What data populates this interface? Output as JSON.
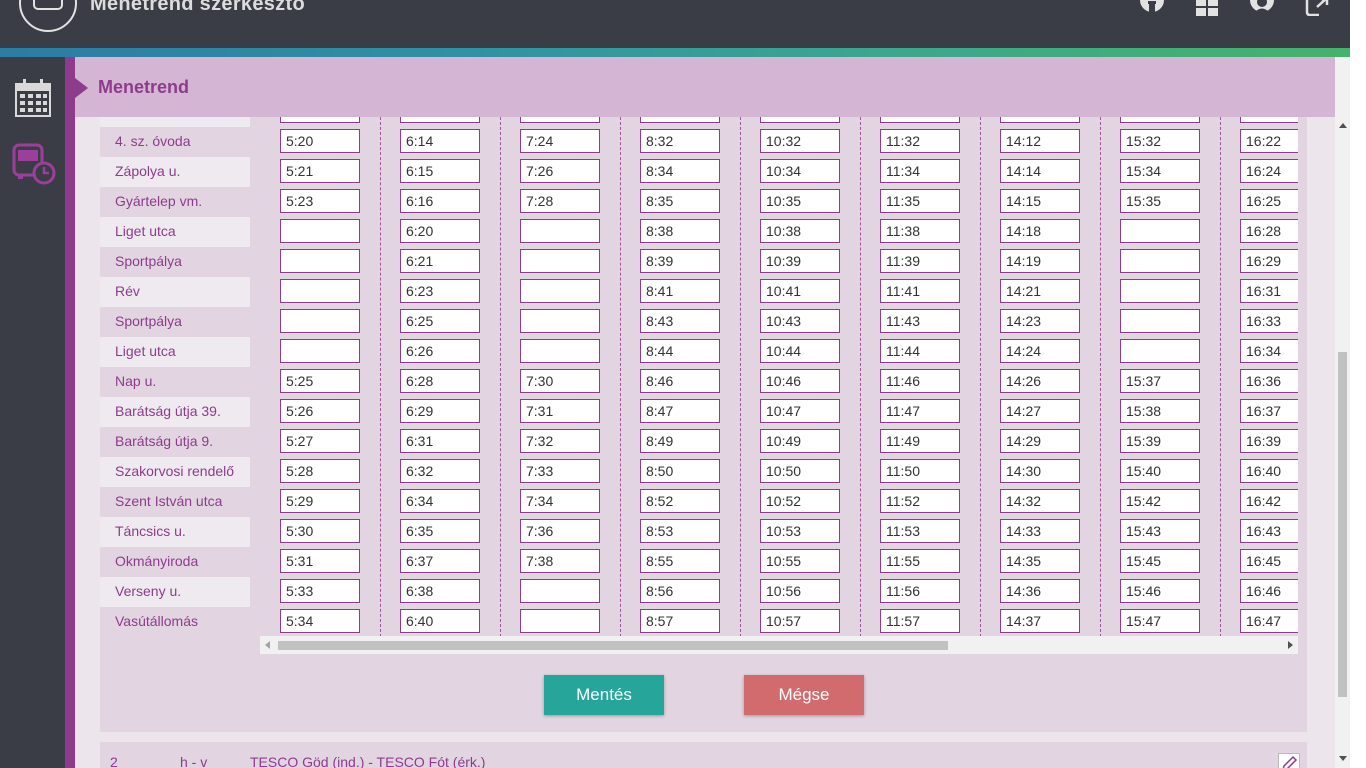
{
  "app": {
    "title": "Menetrend szerkesztő"
  },
  "page": {
    "title": "Menetrend"
  },
  "header_icons": [
    "home-icon",
    "grid-icon",
    "user-icon",
    "logout-icon"
  ],
  "sidebar_icons": [
    "calendar-icon",
    "bus-schedule-icon"
  ],
  "timetable": {
    "rows": [
      {
        "stop": "4. sz. óvoda",
        "times": [
          "5:20",
          "6:14",
          "7:24",
          "8:32",
          "10:32",
          "11:32",
          "14:12",
          "15:32",
          "16:22"
        ]
      },
      {
        "stop": "Zápolya u.",
        "times": [
          "5:21",
          "6:15",
          "7:26",
          "8:34",
          "10:34",
          "11:34",
          "14:14",
          "15:34",
          "16:24"
        ]
      },
      {
        "stop": "Gyártelep vm.",
        "times": [
          "5:23",
          "6:16",
          "7:28",
          "8:35",
          "10:35",
          "11:35",
          "14:15",
          "15:35",
          "16:25"
        ]
      },
      {
        "stop": "Liget utca",
        "times": [
          "",
          "6:20",
          "",
          "8:38",
          "10:38",
          "11:38",
          "14:18",
          "",
          "16:28"
        ]
      },
      {
        "stop": "Sportpálya",
        "times": [
          "",
          "6:21",
          "",
          "8:39",
          "10:39",
          "11:39",
          "14:19",
          "",
          "16:29"
        ]
      },
      {
        "stop": "Rév",
        "times": [
          "",
          "6:23",
          "",
          "8:41",
          "10:41",
          "11:41",
          "14:21",
          "",
          "16:31"
        ]
      },
      {
        "stop": "Sportpálya",
        "times": [
          "",
          "6:25",
          "",
          "8:43",
          "10:43",
          "11:43",
          "14:23",
          "",
          "16:33"
        ]
      },
      {
        "stop": "Liget utca",
        "times": [
          "",
          "6:26",
          "",
          "8:44",
          "10:44",
          "11:44",
          "14:24",
          "",
          "16:34"
        ]
      },
      {
        "stop": "Nap u.",
        "times": [
          "5:25",
          "6:28",
          "7:30",
          "8:46",
          "10:46",
          "11:46",
          "14:26",
          "15:37",
          "16:36"
        ]
      },
      {
        "stop": "Barátság útja 39.",
        "times": [
          "5:26",
          "6:29",
          "7:31",
          "8:47",
          "10:47",
          "11:47",
          "14:27",
          "15:38",
          "16:37"
        ]
      },
      {
        "stop": "Barátság útja 9.",
        "times": [
          "5:27",
          "6:31",
          "7:32",
          "8:49",
          "10:49",
          "11:49",
          "14:29",
          "15:39",
          "16:39"
        ]
      },
      {
        "stop": "Szakorvosi rendelő",
        "times": [
          "5:28",
          "6:32",
          "7:33",
          "8:50",
          "10:50",
          "11:50",
          "14:30",
          "15:40",
          "16:40"
        ]
      },
      {
        "stop": "Szent István utca",
        "times": [
          "5:29",
          "6:34",
          "7:34",
          "8:52",
          "10:52",
          "11:52",
          "14:32",
          "15:42",
          "16:42"
        ]
      },
      {
        "stop": "Táncsics u.",
        "times": [
          "5:30",
          "6:35",
          "7:36",
          "8:53",
          "10:53",
          "11:53",
          "14:33",
          "15:43",
          "16:43"
        ]
      },
      {
        "stop": "Okmányiroda",
        "times": [
          "5:31",
          "6:37",
          "7:38",
          "8:55",
          "10:55",
          "11:55",
          "14:35",
          "15:45",
          "16:45"
        ]
      },
      {
        "stop": "Verseny u.",
        "times": [
          "5:33",
          "6:38",
          "",
          "8:56",
          "10:56",
          "11:56",
          "14:36",
          "15:46",
          "16:46"
        ]
      },
      {
        "stop": "Vasútállomás",
        "times": [
          "5:34",
          "6:40",
          "",
          "8:57",
          "10:57",
          "11:57",
          "14:37",
          "15:47",
          "16:47"
        ]
      }
    ]
  },
  "buttons": {
    "save": "Mentés",
    "cancel": "Mégse"
  },
  "next_route": {
    "number": "2",
    "days": "h - v",
    "name": "TESCO Göd (ind.) - TESCO Fót (érk.)"
  }
}
